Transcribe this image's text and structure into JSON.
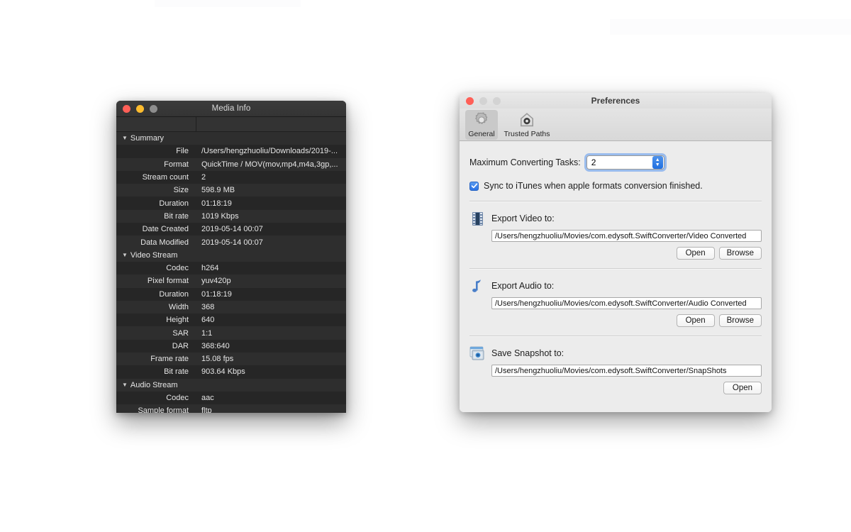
{
  "media_info": {
    "window_title": "Media Info",
    "traffic_lights": [
      "close-red",
      "minimize-yellow",
      "zoom-gray"
    ],
    "rows": [
      {
        "type": "group",
        "key": "Summary",
        "value": ""
      },
      {
        "type": "item",
        "key": "File",
        "value": "/Users/hengzhuoliu/Downloads/2019-..."
      },
      {
        "type": "item",
        "key": "Format",
        "value": "QuickTime / MOV(mov,mp4,m4a,3gp,..."
      },
      {
        "type": "item",
        "key": "Stream count",
        "value": "2"
      },
      {
        "type": "item",
        "key": "Size",
        "value": "598.9 MB"
      },
      {
        "type": "item",
        "key": "Duration",
        "value": "01:18:19"
      },
      {
        "type": "item",
        "key": "Bit rate",
        "value": "1019 Kbps"
      },
      {
        "type": "item",
        "key": "Date Created",
        "value": "2019-05-14 00:07"
      },
      {
        "type": "item",
        "key": "Data Modified",
        "value": "2019-05-14 00:07"
      },
      {
        "type": "group",
        "key": "Video Stream",
        "value": ""
      },
      {
        "type": "item",
        "key": "Codec",
        "value": "h264"
      },
      {
        "type": "item",
        "key": "Pixel format",
        "value": "yuv420p"
      },
      {
        "type": "item",
        "key": "Duration",
        "value": "01:18:19"
      },
      {
        "type": "item",
        "key": "Width",
        "value": "368"
      },
      {
        "type": "item",
        "key": "Height",
        "value": "640"
      },
      {
        "type": "item",
        "key": "SAR",
        "value": "1:1"
      },
      {
        "type": "item",
        "key": "DAR",
        "value": "368:640"
      },
      {
        "type": "item",
        "key": "Frame rate",
        "value": "15.08 fps"
      },
      {
        "type": "item",
        "key": "Bit rate",
        "value": "903.64 Kbps"
      },
      {
        "type": "group",
        "key": "Audio Stream",
        "value": ""
      },
      {
        "type": "item",
        "key": "Codec",
        "value": "aac"
      },
      {
        "type": "item",
        "key": "Sample format",
        "value": "fltp"
      }
    ]
  },
  "preferences": {
    "window_title": "Preferences",
    "toolbar": [
      {
        "label": "General",
        "icon": "gear-icon",
        "selected": true
      },
      {
        "label": "Trusted Paths",
        "icon": "house-shield-icon",
        "selected": false
      }
    ],
    "max_tasks": {
      "label": "Maximum Converting Tasks:",
      "value": "2"
    },
    "sync_checkbox": {
      "label": "Sync to iTunes when apple formats conversion finished.",
      "checked": true
    },
    "sections": [
      {
        "icon": "film-strip-icon",
        "title": "Export Video to:",
        "path": "/Users/hengzhuoliu/Movies/com.edysoft.SwiftConverter/Video Converted",
        "buttons": [
          "Open",
          "Browse"
        ]
      },
      {
        "icon": "music-note-icon",
        "title": "Export Audio to:",
        "path": "/Users/hengzhuoliu/Movies/com.edysoft.SwiftConverter/Audio Converted",
        "buttons": [
          "Open",
          "Browse"
        ]
      },
      {
        "icon": "snapshot-camera-icon",
        "title": "Save Snapshot to:",
        "path": "/Users/hengzhuoliu/Movies/com.edysoft.SwiftConverter/SnapShots",
        "buttons": [
          "Open"
        ]
      }
    ]
  },
  "colors": {
    "accent_blue": "#2b72e4",
    "dark_window_bg": "#2b2b2b",
    "light_window_bg": "#ececec",
    "desktop_bg": "#ffffff"
  }
}
